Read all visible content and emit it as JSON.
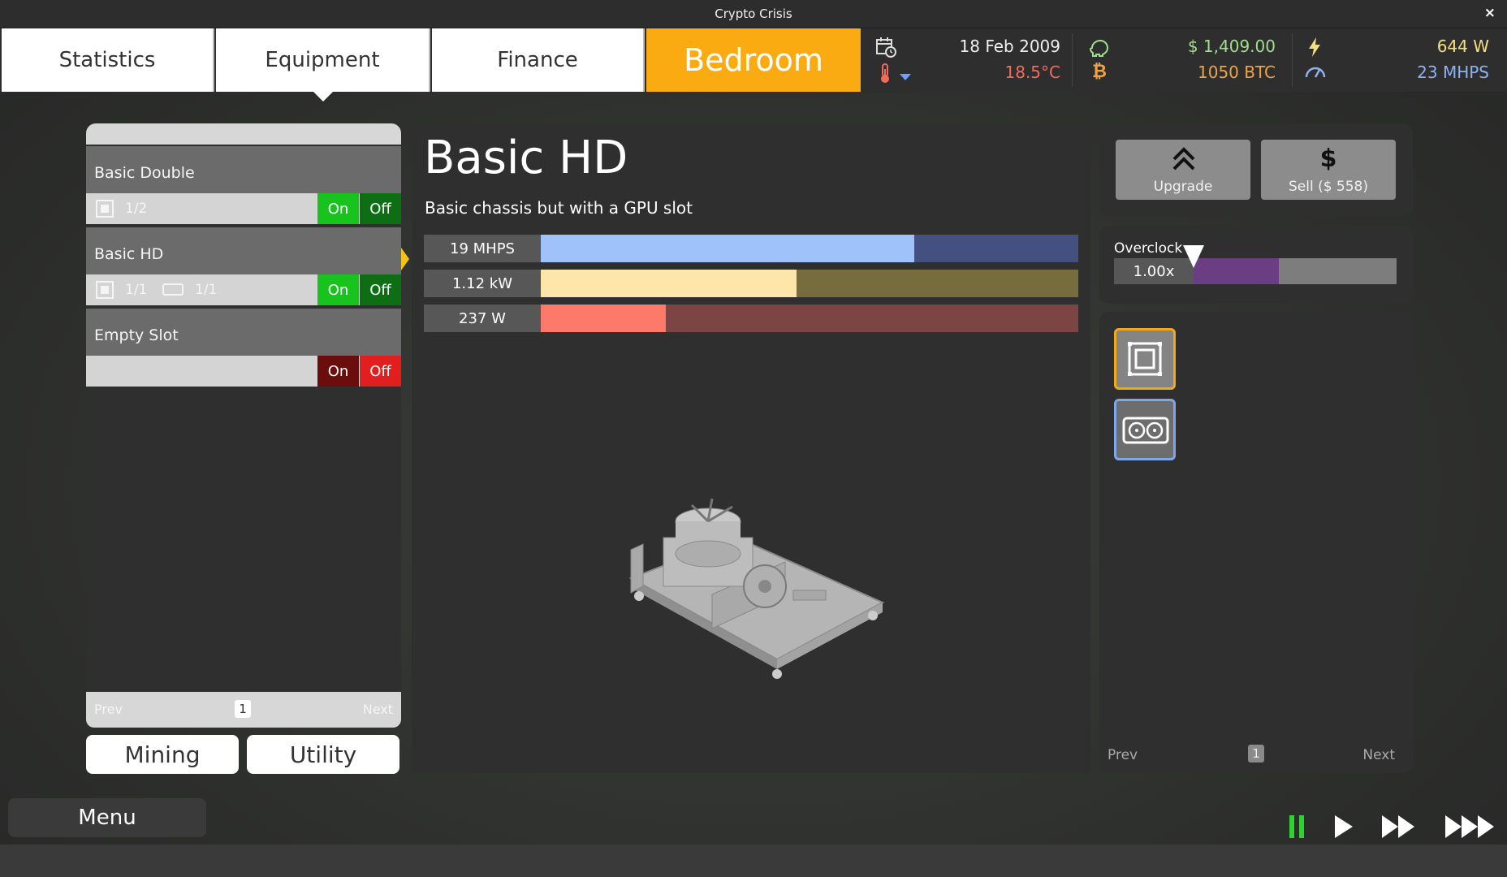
{
  "window": {
    "title": "Crypto Crisis",
    "close": "×"
  },
  "tabs": [
    {
      "label": "Statistics"
    },
    {
      "label": "Equipment"
    },
    {
      "label": "Finance"
    },
    {
      "label": "Bedroom"
    }
  ],
  "status": {
    "date": "18 Feb 2009",
    "temperature": "18.5°C",
    "cash": "$ 1,409.00",
    "btc": "1050 BTC",
    "power": "644 W",
    "hashrate": "23 MHPS"
  },
  "equipment_list": {
    "items": [
      {
        "name": "Basic Double",
        "cpu_count": "1/2",
        "gpu_count": "",
        "on": "On",
        "off": "Off",
        "state": "on"
      },
      {
        "name": "Basic HD",
        "cpu_count": "1/1",
        "gpu_count": "1/1",
        "on": "On",
        "off": "Off",
        "state": "on"
      },
      {
        "name": "Empty Slot",
        "cpu_count": "",
        "gpu_count": "",
        "on": "On",
        "off": "Off",
        "state": "off"
      }
    ],
    "pager": {
      "prev": "Prev",
      "page": "1",
      "next": "Next"
    }
  },
  "categories": {
    "mining": "Mining",
    "utility": "Utility"
  },
  "detail": {
    "name": "Basic HD",
    "description": "Basic chassis but with a GPU slot",
    "bars": [
      {
        "label": "19 MHPS",
        "fraction": 0.695,
        "fill": "#9ec2f9",
        "track": "#445080"
      },
      {
        "label": "1.12 kW",
        "fraction": 0.476,
        "fill": "#fee5a9",
        "track": "#766c3e"
      },
      {
        "label": "237 W",
        "fraction": 0.233,
        "fill": "#fd7a6b",
        "track": "#7d4444"
      }
    ]
  },
  "actions": {
    "upgrade": "Upgrade",
    "sell": "Sell ($ 558)"
  },
  "overclock": {
    "label": "Overclock",
    "value": "1.00x",
    "fraction": 0.42
  },
  "components": {
    "prev": "Prev",
    "page": "1",
    "next": "Next"
  },
  "menu": {
    "label": "Menu"
  },
  "colors": {
    "accent": "#fbab12",
    "cash": "#9fe08a",
    "btc": "#f0a342",
    "power": "#f4e07a",
    "hashrate": "#8eb2f0",
    "temperature": "#f26b5b"
  }
}
